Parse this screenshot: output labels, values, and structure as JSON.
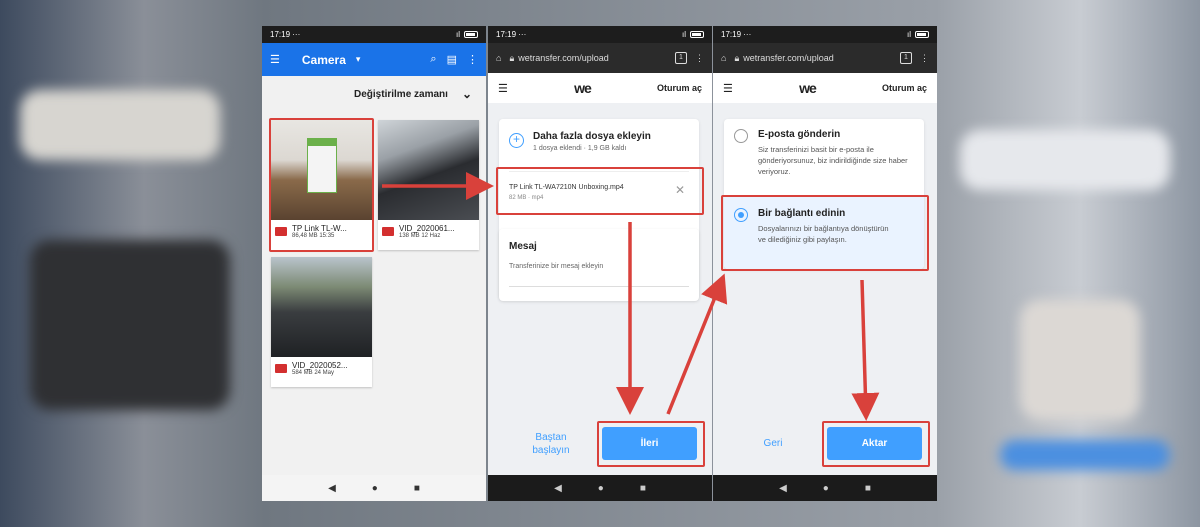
{
  "status_time": "17:19",
  "status_dots": "···",
  "signal": "ıl",
  "files_app": {
    "title": "Camera",
    "sort_label": "Değiştirilme zamanı",
    "files": [
      {
        "name": "TP Link TL-W...",
        "meta": "86,48 MB 15:35"
      },
      {
        "name": "VID_2020061...",
        "meta": "138 MB 12 Haz"
      },
      {
        "name": "VID_2020052...",
        "meta": "584 MB 24 May"
      }
    ]
  },
  "browser": {
    "url": "wetransfer.com/upload",
    "tab_count": "1"
  },
  "wetransfer": {
    "logo": "we",
    "login": "Oturum aç",
    "step1": {
      "add_more": "Daha fazla dosya ekleyin",
      "added_info": "1 dosya eklendi · 1,9 GB kaldı",
      "file_name": "TP Link TL-WA7210N Unboxing.mp4",
      "file_meta": "82 MB · mp4",
      "message_title": "Mesaj",
      "message_placeholder": "Transferinize bir mesaj ekleyin",
      "restart": "Baştan başlayın",
      "next": "İleri"
    },
    "step2": {
      "email_title": "E-posta gönderin",
      "email_desc": "Siz transferinizi basit bir e-posta ile gönderiyorsunuz, biz indirildiğinde size haber veriyoruz.",
      "link_title": "Bir bağlantı edinin",
      "link_desc": "Dosyalarınızı bir bağlantıya dönüştürün ve dilediğiniz gibi paylaşın.",
      "back": "Geri",
      "transfer": "Aktar"
    }
  },
  "colors": {
    "accent": "#409fff",
    "highlight": "#d9413b",
    "appbar": "#1a73e8"
  }
}
